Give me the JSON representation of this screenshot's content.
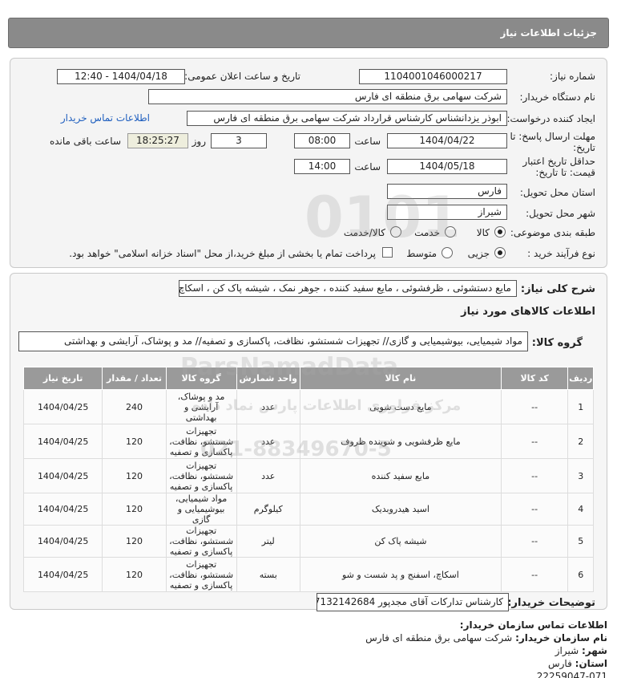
{
  "header": {
    "title": "جزئیات اطلاعات نیاز"
  },
  "form": {
    "need_number_label": "شماره نیاز:",
    "need_number": "1104001046000217",
    "announce_label": "تاریخ و ساعت اعلان عمومی:",
    "announce_value": "1404/04/18 - 12:40",
    "buyer_org_label": "نام دستگاه خریدار:",
    "buyer_org": "شرکت سهامی برق منطقه ای فارس",
    "creator_label": "ایجاد کننده درخواست:",
    "creator": "ابوذر  یزدانشناس کارشناس قرارداد شرکت سهامی برق منطقه ای فارس",
    "contact_link": "اطلاعات تماس خریدار",
    "deadline_label_1": "مهلت ارسال پاسخ: تا",
    "deadline_label_2": "تاریخ:",
    "deadline_date": "1404/04/22",
    "time_label": "ساعت",
    "deadline_time": "08:00",
    "days_value": "3",
    "days_label": "روز و",
    "remaining_time": "18:25:27",
    "remaining_label": "ساعت باقی مانده",
    "validity_label_1": "حداقل تاریخ اعتبار",
    "validity_label_2": "قیمت: تا تاریخ:",
    "validity_date": "1404/05/18",
    "validity_time": "14:00",
    "province_label": "استان محل تحویل:",
    "province": "فارس",
    "city_label": "شهر محل تحویل:",
    "city": "شیراز",
    "category_label": "طبقه بندی موضوعی:",
    "category_options": [
      "کالا",
      "خدمت",
      "کالا/خدمت"
    ],
    "process_label": "نوع فرآیند خرید :",
    "process_options": [
      "جزیی",
      "متوسط"
    ],
    "payment_note": "پرداخت تمام یا بخشی از مبلغ خرید،از محل \"اسناد خزانه اسلامی\" خواهد بود."
  },
  "summary": {
    "general_desc_label": "شرح کلی نیاز:",
    "general_desc": "مایع دستشوئی ، ظرفشوئی ، مایع سفید کننده ، جوهر نمک ، شیشه پاک کن ، اسکاچ",
    "goods_info_title": "اطلاعات کالاهای مورد نیاز",
    "goods_group_label": "گروه کالا:",
    "goods_group": "مواد شیمیایی، بیوشیمیایی و گازی// تجهیزات شستشو، نظافت، پاکسازی و تصفیه// مد و پوشاک، آرایشی و بهداشتی"
  },
  "table": {
    "headers": [
      "ردیف",
      "کد کالا",
      "نام کالا",
      "واحد شمارش",
      "گروه کالا",
      "تعداد / مقدار",
      "تاریخ نیاز"
    ],
    "rows": [
      [
        "1",
        "--",
        "مایع دست شویی",
        "عدد",
        "مد و پوشاک، آرایشی و بهداشتی",
        "240",
        "1404/04/25"
      ],
      [
        "2",
        "--",
        "مایع ظرفشویی و شوینده ظروف",
        "عدد",
        "تجهیزات شستشو، نظافت، پاکسازی و تصفیه",
        "120",
        "1404/04/25"
      ],
      [
        "3",
        "--",
        "مایع سفید کننده",
        "عدد",
        "تجهیزات شستشو، نظافت، پاکسازی و تصفیه",
        "120",
        "1404/04/25"
      ],
      [
        "4",
        "--",
        "اسید هیدروبدیک",
        "کیلوگرم",
        "مواد شیمیایی، بیوشیمیایی و گازی",
        "120",
        "1404/04/25"
      ],
      [
        "5",
        "--",
        "شیشه پاک کن",
        "لیتر",
        "تجهیزات شستشو، نظافت، پاکسازی و تصفیه",
        "120",
        "1404/04/25"
      ],
      [
        "6",
        "--",
        "اسکاچ، اسفنج و پد شست و شو",
        "بسته",
        "تجهیزات شستشو، نظافت، پاکسازی و تصفیه",
        "120",
        "1404/04/25"
      ]
    ]
  },
  "buyer_notes": {
    "label": "توضیحات خریدار:",
    "value": "کارشناس تدارکات آقای مجدپور 07132142684"
  },
  "contact": {
    "title": "اطلاعات تماس سازمان خریدار:",
    "org_label": "نام سازمان خریدار:",
    "org": "شرکت سهامی برق منطقه ای فارس",
    "city_label": "شهر:",
    "city": "شیراز",
    "province_label": "استان:",
    "province": "فارس",
    "phone_partial": "22259047-071"
  },
  "watermark": {
    "brand": "ParsNamadData",
    "text_fa": "مرکز فراوری اطلاعات پارس نماد داده",
    "phone": "021-88349670-5",
    "number": "0101"
  }
}
